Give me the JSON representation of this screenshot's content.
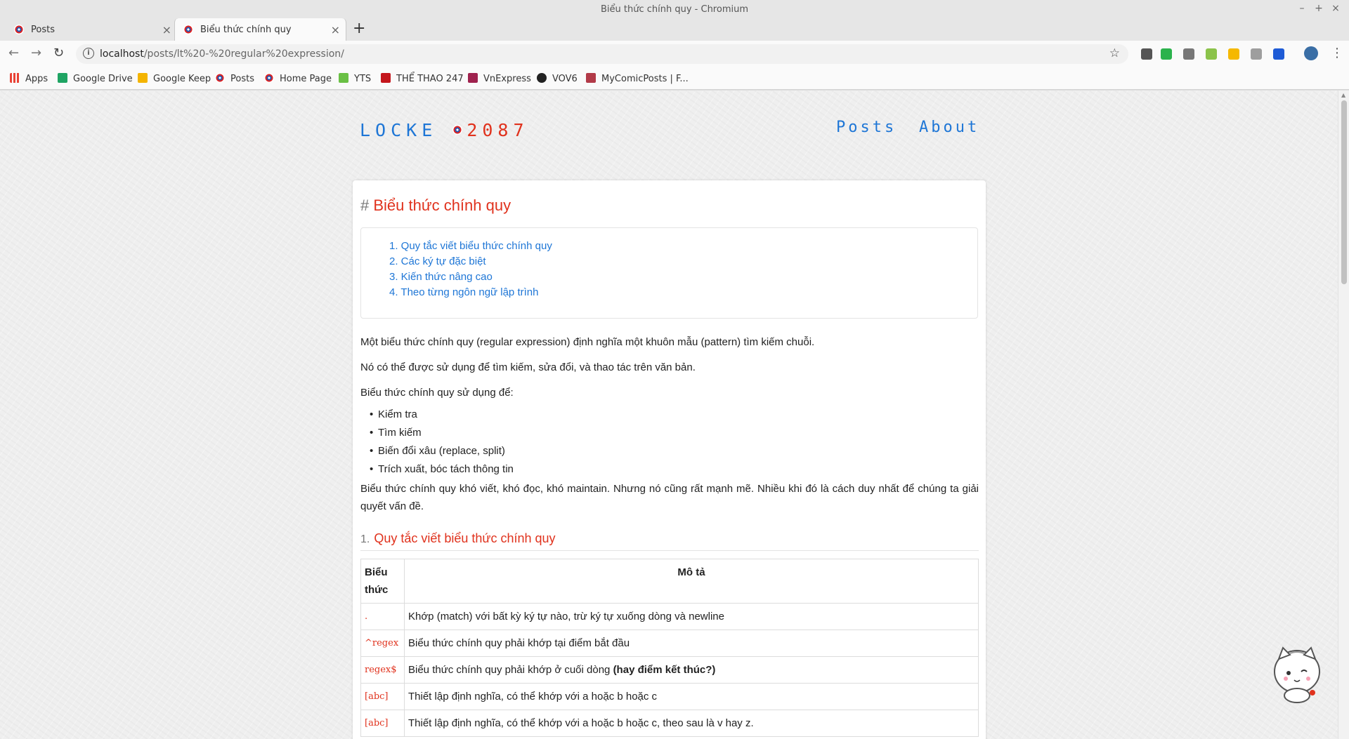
{
  "window": {
    "title": "Biểu thức chính quy - Chromium",
    "controls": [
      "–",
      "+",
      "×"
    ]
  },
  "tabs": [
    {
      "label": "Posts",
      "active": false
    },
    {
      "label": "Biểu thức chính quy",
      "active": true
    }
  ],
  "toolbar": {
    "url_host": "localhost",
    "url_path": "/posts/lt%20-%20regular%20expression/"
  },
  "bookmarks": [
    {
      "label": "Apps",
      "color": "#e94235"
    },
    {
      "label": "Google Drive",
      "color": "#1fa463"
    },
    {
      "label": "Google Keep",
      "color": "#f4b400"
    },
    {
      "label": "Posts",
      "color": "#2458b0"
    },
    {
      "label": "Home Page",
      "color": "#2458b0"
    },
    {
      "label": "YTS",
      "color": "#6ac045"
    },
    {
      "label": "THỂ THAO 247",
      "color": "#c4161c"
    },
    {
      "label": "VnExpress",
      "color": "#9f224e"
    },
    {
      "label": "VOV6",
      "color": "#222222"
    },
    {
      "label": "MyComicPosts | F...",
      "color": "#b23a48"
    }
  ],
  "site": {
    "logo_left": "LOCKE",
    "logo_right": "2087",
    "nav": [
      "Posts",
      "About"
    ]
  },
  "post": {
    "title": "Biểu thức chính quy",
    "toc": [
      "1. Quy tắc viết biểu thức chính quy",
      "2. Các ký tự đặc biệt",
      "3. Kiến thức nâng cao",
      "4. Theo từng ngôn ngữ lập trình"
    ],
    "para1": "Một biểu thức chính quy (regular expression) định nghĩa một khuôn mẫu (pattern) tìm kiếm chuỗi.",
    "para2": "Nó có thể được sử dụng để tìm kiếm, sửa đổi, và thao tác trên văn bản.",
    "para3": "Biểu thức chính quy sử dụng để:",
    "uses": [
      "Kiểm tra",
      "Tìm kiếm",
      "Biến đổi xâu (replace, split)",
      "Trích xuất, bóc tách thông tin"
    ],
    "para4": "Biểu thức chính quy khó viết, khó đọc, khó maintain. Nhưng nó cũng rất mạnh mẽ. Nhiều khi đó là cách duy nhất để chúng ta giải quyết vấn đề.",
    "section1_num": "1.",
    "section1_title": "Quy tắc viết biểu thức chính quy",
    "table": {
      "header_expr": "Biểu thức",
      "header_desc": "Mô tả",
      "rows": [
        {
          "expr": ".",
          "desc": "Khớp (match) với bất kỳ ký tự nào, trừ ký tự xuống dòng và newline",
          "bold": ""
        },
        {
          "expr": "^regex",
          "desc": "Biểu thức chính quy phải khớp tại điểm bắt đầu",
          "bold": ""
        },
        {
          "expr": "regex$",
          "desc": "Biểu thức chính quy phải khớp ở cuối dòng ",
          "bold": "(hay điểm kết thúc?)"
        },
        {
          "expr": "[abc]",
          "desc": "Thiết lập định nghĩa, có thể khớp với a hoặc b hoặc c",
          "bold": ""
        },
        {
          "expr": "[abc]",
          "desc": "Thiết lập định nghĩa, có thể khớp với a hoặc b hoặc c, theo sau là v hay z.",
          "bold": ""
        }
      ]
    }
  }
}
